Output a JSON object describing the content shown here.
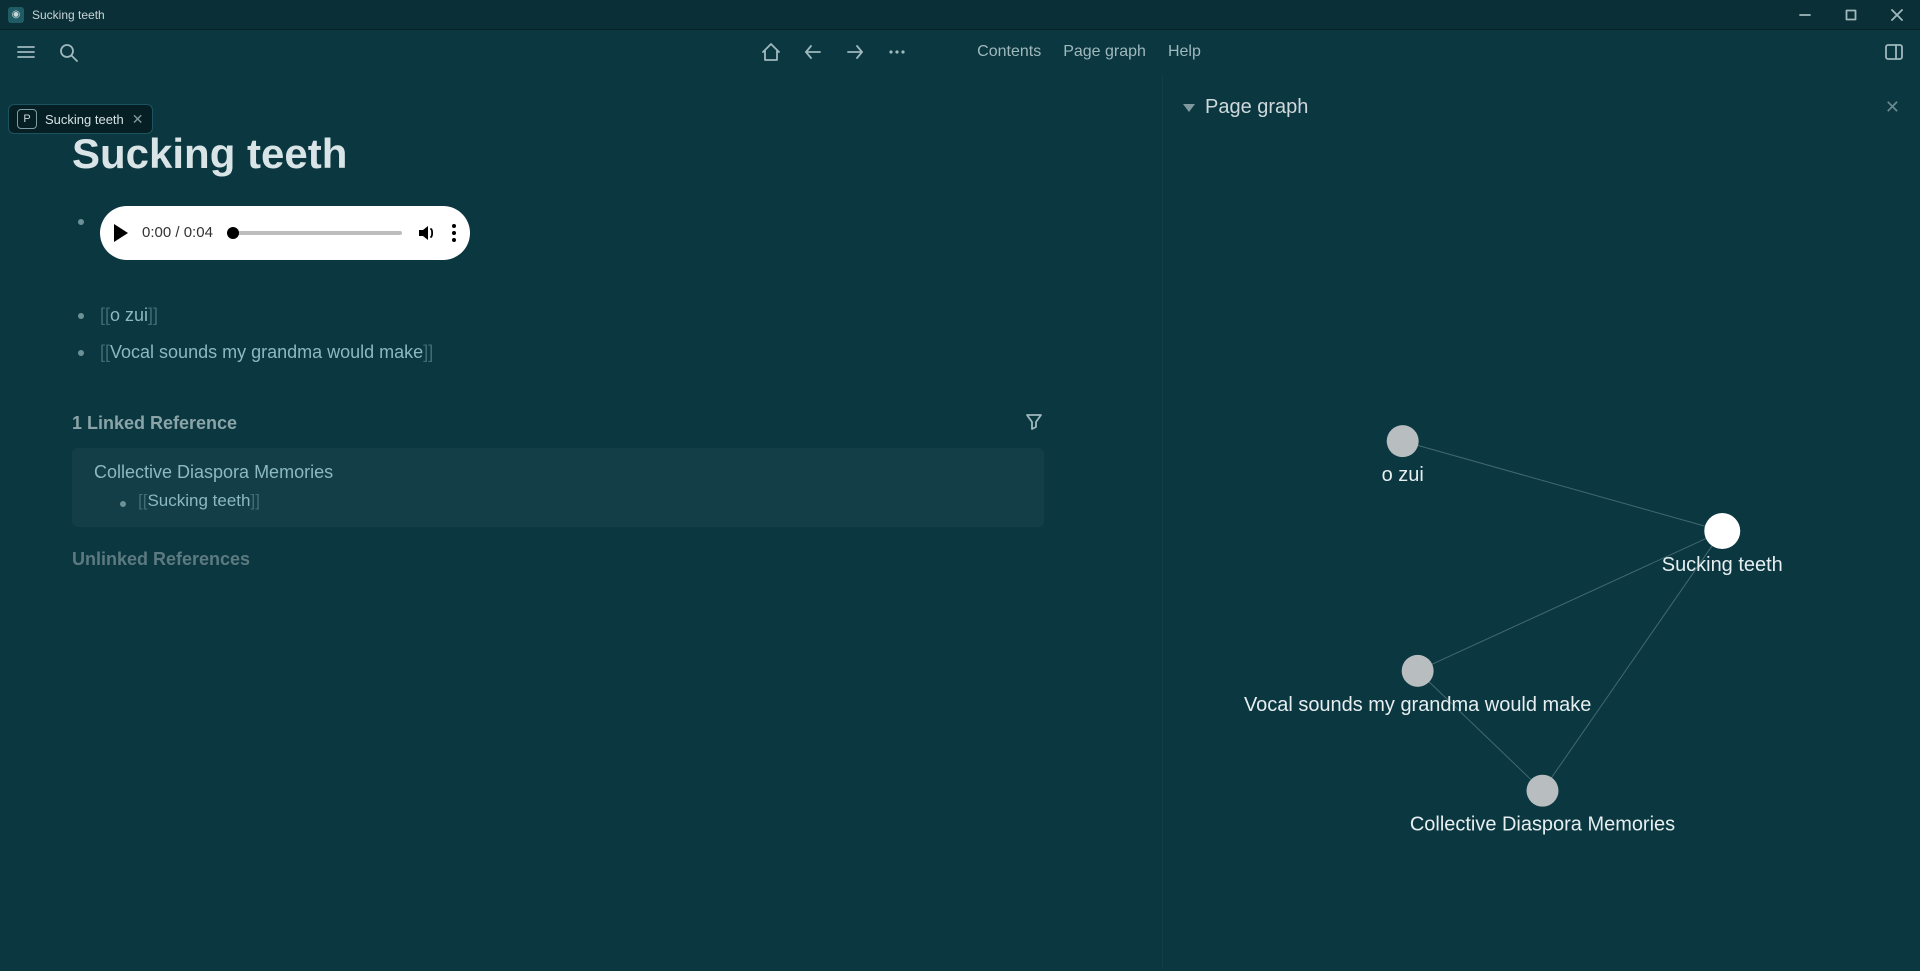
{
  "window": {
    "title": "Sucking teeth"
  },
  "tabs": [
    {
      "badge": "P",
      "label": "Sucking teeth"
    }
  ],
  "toolbar_text": {
    "contents": "Contents",
    "page_graph": "Page graph",
    "help": "Help"
  },
  "page": {
    "title": "Sucking teeth",
    "audio": {
      "current": "0:00",
      "duration": "0:04"
    },
    "links": [
      "o zui",
      "Vocal sounds my grandma would make"
    ],
    "linked_heading": "1 Linked Reference",
    "linked_refs": [
      {
        "title": "Collective Diaspora Memories",
        "items": [
          "Sucking teeth"
        ]
      }
    ],
    "unlinked_heading": "Unlinked References"
  },
  "sidebar": {
    "panel_title": "Page graph",
    "graph": {
      "nodes": [
        {
          "id": "ozui",
          "label": "o zui",
          "active": false
        },
        {
          "id": "sucking",
          "label": "Sucking teeth",
          "active": true
        },
        {
          "id": "vocal",
          "label": "Vocal sounds my grandma would make",
          "active": false
        },
        {
          "id": "collective",
          "label": "Collective Diaspora Memories",
          "active": false
        }
      ],
      "edges": [
        [
          "ozui",
          "sucking"
        ],
        [
          "vocal",
          "sucking"
        ],
        [
          "collective",
          "sucking"
        ],
        [
          "vocal",
          "collective"
        ]
      ]
    }
  }
}
